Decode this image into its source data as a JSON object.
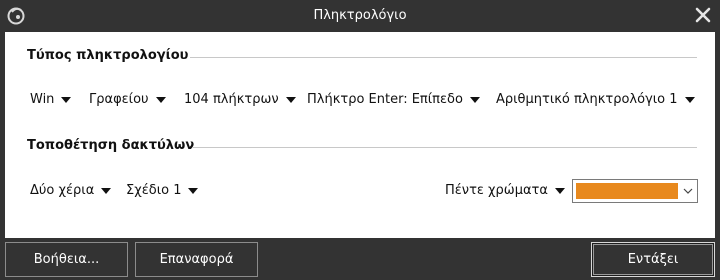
{
  "window": {
    "title": "Πληκτρολόγιο"
  },
  "icons": {
    "app": "app-logo-icon",
    "close": "close-icon",
    "caret": "caret-down-icon",
    "chevron": "chevron-down-icon"
  },
  "keyboard_type": {
    "heading": "Τύπος πληκτρολογίου",
    "os": "Win",
    "layout": "Γραφείου",
    "keys": "104 πλήκτρων",
    "enter_key": "Πλήκτρο Enter: Επίπεδο",
    "numpad": "Αριθμητικό πληκτρολόγιο 1"
  },
  "finger_placement": {
    "heading": "Τοποθέτηση δακτύλων",
    "hands": "Δύο χέρια",
    "scheme": "Σχέδιο 1",
    "colors": "Πέντε χρώματα",
    "color_value": "#e8891e"
  },
  "buttons": {
    "help": "Βοήθεια...",
    "reset": "Επαναφορά",
    "ok": "Εντάξει"
  },
  "colors": {
    "titlebar": "#333333",
    "panel": "#ffffff",
    "accent_orange": "#e8891e"
  }
}
